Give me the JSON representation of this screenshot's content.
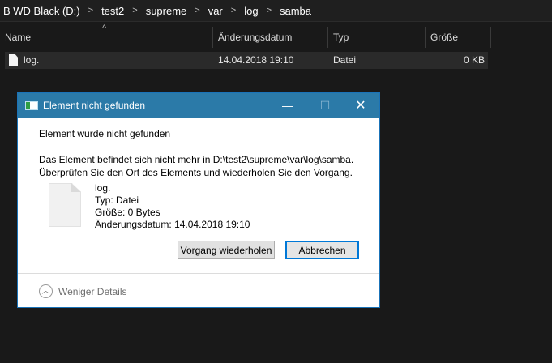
{
  "breadcrumb": {
    "items": [
      "B WD Black (D:)",
      "test2",
      "supreme",
      "var",
      "log",
      "samba"
    ],
    "separator": ">"
  },
  "columns": {
    "name": "Name",
    "date": "Änderungsdatum",
    "type": "Typ",
    "size": "Größe",
    "sort_indicator": "^"
  },
  "file": {
    "name": "log.",
    "date": "14.04.2018 19:10",
    "type": "Datei",
    "size": "0 KB",
    "icon": "file-icon"
  },
  "dialog": {
    "title": "Element nicht gefunden",
    "title_icon": "folder-move-icon",
    "headline": "Element wurde nicht gefunden",
    "message_line1": "Das Element befindet sich nicht mehr in D:\\test2\\supreme\\var\\log\\samba.",
    "message_line2": "Überprüfen Sie den Ort des Elements und wiederholen Sie den Vorgang.",
    "item": {
      "name": "log.",
      "type": "Typ: Datei",
      "size": "Größe: 0 Bytes",
      "date": "Änderungsdatum: 14.04.2018 19:10"
    },
    "retry_label": "Vorgang wiederholen",
    "cancel_label": "Abbrechen",
    "less_details_label": "Weniger Details",
    "minimize_glyph": "—",
    "maximize_glyph": "☐",
    "close_glyph": "✕",
    "chevron_glyph": "︿"
  },
  "colors": {
    "background": "#191919",
    "titlebar": "#2b7aa8",
    "accent": "#0078d7"
  }
}
